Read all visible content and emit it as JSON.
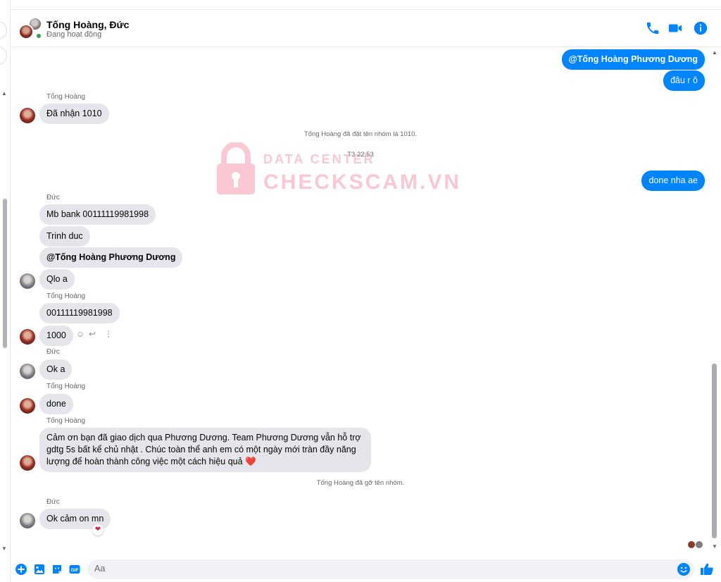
{
  "header": {
    "title": "Tống Hoàng, Đức",
    "status": "Đang hoạt động"
  },
  "colors": {
    "accent": "#0084ff",
    "bubble_in": "#e4e6eb",
    "online": "#31a24c",
    "heart": "#e41e3f"
  },
  "icons": {
    "call": "phone-icon",
    "video": "video-camera-icon",
    "info": "info-icon"
  },
  "watermark": {
    "line1": "DATA CENTER",
    "line2": "CHECKSCAM.VN"
  },
  "messages": {
    "out1": "@Tống Hoàng Phương Dương",
    "out2": "đâu r ô",
    "s1": "Tống Hoàng",
    "m1": "Đã nhận 1010",
    "sys1": "Tống Hoàng đã đặt tên nhóm là 1010.",
    "time1": "T3 22:53",
    "out3": "done nha ae",
    "s2": "Đức",
    "m2": "Mb bank 00111119981998",
    "m3": "Trinh duc",
    "m4": "@Tống Hoàng Phương Dương",
    "m5": "Qlo a",
    "s3": "Tống Hoàng",
    "m6": "00111119981998",
    "m7": "1000",
    "s4": "Đức",
    "m8": "Ok a",
    "s5": "Tống Hoàng",
    "m9": "done",
    "s6": "Tống Hoàng",
    "m10": "Cảm ơn bạn đã giao dịch qua Phương Dương. Team Phương Dương vẫn hỗ trợ gdtg 5s bất kể chủ nhật . Chúc toàn thể anh em có một ngày mới tràn đầy năng lượng để hoàn thành công việc một cách hiệu quả",
    "m10_emoji": "❤️",
    "sys2": "Tống Hoàng đã gỡ tên nhóm.",
    "s7": "Đức",
    "m11": "Ok cảm on mn",
    "m11_reaction": "❤"
  },
  "composer": {
    "placeholder": "Aa",
    "icons": [
      "plus-icon",
      "image-icon",
      "sticker-icon",
      "gif-icon",
      "emoji-icon",
      "like-icon"
    ],
    "gif_label": "GIF"
  }
}
